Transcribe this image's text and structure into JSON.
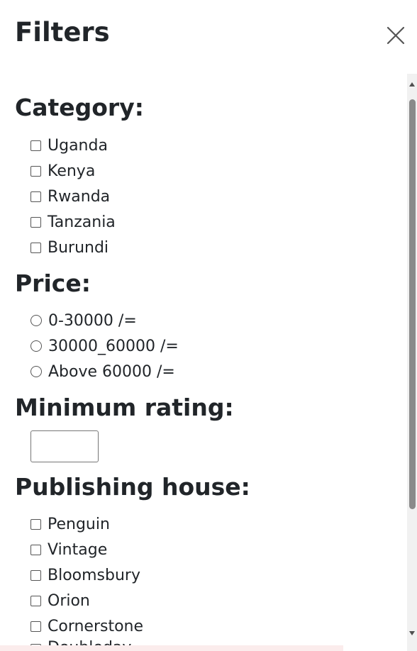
{
  "panel": {
    "title": "Filters"
  },
  "category": {
    "title": "Category:",
    "options": [
      "Uganda",
      "Kenya",
      "Rwanda",
      "Tanzania",
      "Burundi"
    ]
  },
  "price": {
    "title": "Price:",
    "options": [
      "0-30000 /=",
      "30000_60000 /=",
      "Above 60000 /="
    ]
  },
  "rating": {
    "title": "Minimum rating:",
    "value": ""
  },
  "publisher": {
    "title": "Publishing house:",
    "options": [
      "Penguin",
      "Vintage",
      "Bloomsbury",
      "Orion",
      "Cornerstone",
      "Doubleday"
    ]
  },
  "icons": {
    "close": "close-icon"
  }
}
